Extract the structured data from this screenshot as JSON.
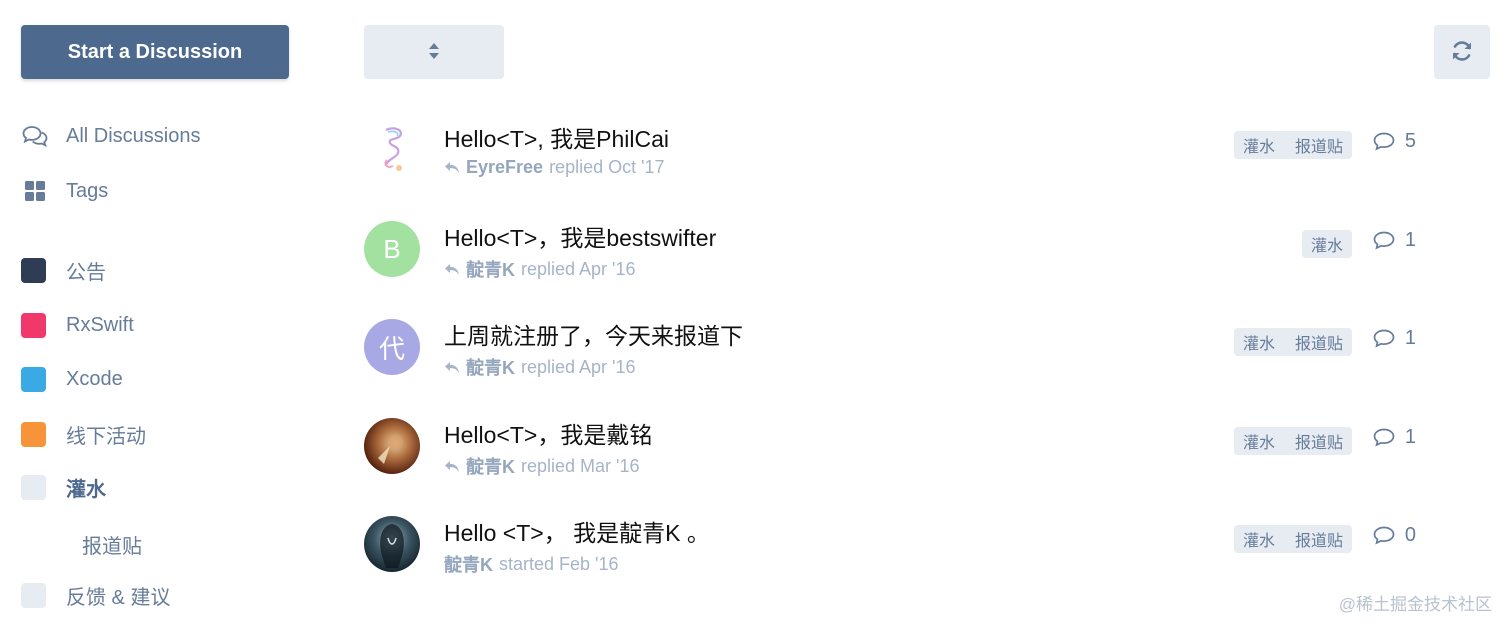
{
  "sidebar": {
    "start_label": "Start a Discussion",
    "nav": [
      {
        "label": "All Discussions",
        "icon": "comments-icon"
      },
      {
        "label": "Tags",
        "icon": "grid-icon"
      }
    ],
    "tags": [
      {
        "label": "公告",
        "color": "#2e3d54"
      },
      {
        "label": "RxSwift",
        "color": "#f0396a"
      },
      {
        "label": "Xcode",
        "color": "#3aa9e4"
      },
      {
        "label": "线下活动",
        "color": "#f79439"
      },
      {
        "label": "灌水",
        "color": "#e7ebf2",
        "active": true
      },
      {
        "label": "反馈 & 建议",
        "color": "#e7ebf2"
      }
    ],
    "subtag": "报道贴"
  },
  "toolbar": {
    "sort_icon": "sort-icon",
    "refresh_icon": "refresh-icon"
  },
  "discussions": [
    {
      "title": "Hello<T>, 我是PhilCai",
      "user": "EyreFree",
      "action": "replied Oct '17",
      "tags": [
        "灌水",
        "报道贴"
      ],
      "count": "5",
      "avatar_letter": "",
      "avatar_color": "#ffffff"
    },
    {
      "title": "Hello<T>，我是bestswifter",
      "user": "靛青K",
      "action": "replied Apr '16",
      "tags": [
        "灌水"
      ],
      "count": "1",
      "avatar_letter": "B",
      "avatar_color": "#a3e1a0"
    },
    {
      "title": "上周就注册了，今天来报道下",
      "user": "靛青K",
      "action": "replied Apr '16",
      "tags": [
        "灌水",
        "报道贴"
      ],
      "count": "1",
      "avatar_letter": "代",
      "avatar_color": "#a8a8e5"
    },
    {
      "title": "Hello<T>，我是戴铭",
      "user": "靛青K",
      "action": "replied Mar '16",
      "tags": [
        "灌水",
        "报道贴"
      ],
      "count": "1",
      "avatar_letter": "",
      "avatar_color": "#7a3a1c"
    },
    {
      "title": "Hello <T>， 我是靛青K 。",
      "user": "靛青K",
      "action": "started Feb '16",
      "tags": [
        "灌水",
        "报道贴"
      ],
      "count": "0",
      "avatar_letter": "",
      "avatar_color": "#1b2a33"
    }
  ],
  "colors": {
    "accent": "#4d698e",
    "muted": "#667c99",
    "control_bg": "#e7ebf2"
  },
  "watermark": "@稀土掘金技术社区"
}
